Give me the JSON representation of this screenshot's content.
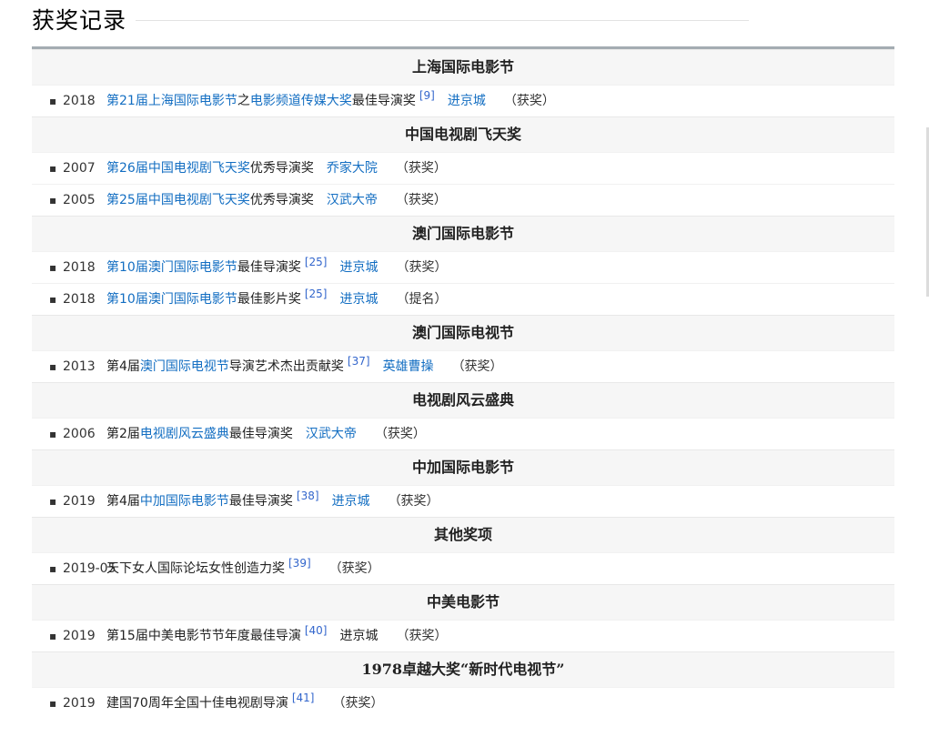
{
  "heading": "获奖记录",
  "sections": [
    {
      "title": "上海国际电影节",
      "rows": [
        {
          "year": "2018",
          "pre": "",
          "link1": "第21届上海国际电影节",
          "mid": "之",
          "link2": "电影频道传媒大奖",
          "post": "最佳导演奖",
          "ref": "[9]",
          "work": "进京城",
          "result": "（获奖）"
        }
      ]
    },
    {
      "title": "中国电视剧飞天奖",
      "rows": [
        {
          "year": "2007",
          "pre": "",
          "link1": "第26届中国电视剧飞天奖",
          "mid": "",
          "link2": "",
          "post": "优秀导演奖",
          "ref": "",
          "work": "乔家大院",
          "result": "（获奖）"
        },
        {
          "year": "2005",
          "pre": "",
          "link1": "第25届中国电视剧飞天奖",
          "mid": "",
          "link2": "",
          "post": "优秀导演奖",
          "ref": "",
          "work": "汉武大帝",
          "result": "（获奖）"
        }
      ]
    },
    {
      "title": "澳门国际电影节",
      "rows": [
        {
          "year": "2018",
          "pre": "",
          "link1": "第10届澳门国际电影节",
          "mid": "",
          "link2": "",
          "post": "最佳导演奖",
          "ref": "[25]",
          "work": "进京城",
          "result": "（获奖）"
        },
        {
          "year": "2018",
          "pre": "",
          "link1": "第10届澳门国际电影节",
          "mid": "",
          "link2": "",
          "post": "最佳影片奖",
          "ref": "[25]",
          "work": "进京城",
          "result": "（提名）"
        }
      ]
    },
    {
      "title": "澳门国际电视节",
      "rows": [
        {
          "year": "2013",
          "pre": "第4届",
          "link1": "澳门国际电视节",
          "mid": "",
          "link2": "",
          "post": "导演艺术杰出贡献奖",
          "ref": "[37]",
          "work": "英雄曹操",
          "result": "（获奖）"
        }
      ]
    },
    {
      "title": "电视剧风云盛典",
      "rows": [
        {
          "year": "2006",
          "pre": "第2届",
          "link1": "电视剧风云盛典",
          "mid": "",
          "link2": "",
          "post": "最佳导演奖",
          "ref": "",
          "work": "汉武大帝",
          "result": "（获奖）"
        }
      ]
    },
    {
      "title": "中加国际电影节",
      "rows": [
        {
          "year": "2019",
          "pre": "第4届",
          "link1": "中加国际电影节",
          "mid": "",
          "link2": "",
          "post": "最佳导演奖",
          "ref": "[38]",
          "work": "进京城",
          "result": "（获奖）"
        }
      ]
    },
    {
      "title": "其他奖项",
      "rows": [
        {
          "year": "2019-05",
          "pre": "天下女人国际论坛女性创造力奖",
          "link1": "",
          "mid": "",
          "link2": "",
          "post": "",
          "ref": "[39]",
          "work": "",
          "result": "（获奖）"
        }
      ]
    },
    {
      "title": "中美电影节",
      "rows": [
        {
          "year": "2019",
          "pre": "第15届中美电影节节年度最佳导演",
          "link1": "",
          "mid": "",
          "link2": "",
          "post": "",
          "ref": "[40]",
          "work": "进京城",
          "workPlain": true,
          "result": "（获奖）"
        }
      ]
    },
    {
      "title": "1978卓越大奖“新时代电视节”",
      "rows": [
        {
          "year": "2019",
          "pre": "建国70周年全国十佳电视剧导演",
          "link1": "",
          "mid": "",
          "link2": "",
          "post": "",
          "ref": "[41]",
          "work": "",
          "result": "（获奖）"
        }
      ]
    }
  ]
}
